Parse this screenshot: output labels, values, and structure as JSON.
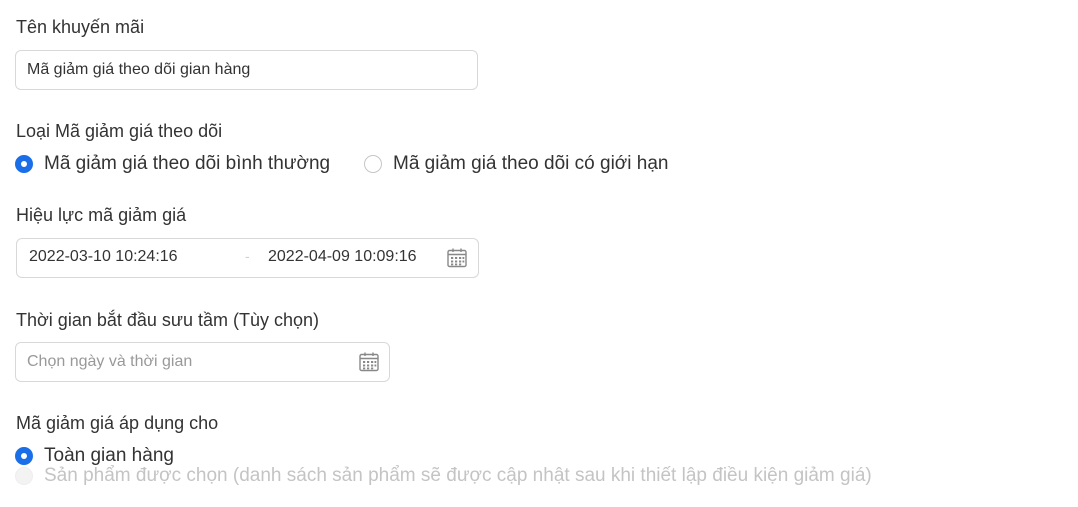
{
  "promo_name": {
    "label": "Tên khuyến mãi",
    "value": "Mã giảm giá theo dõi gian hàng"
  },
  "voucher_type": {
    "label": "Loại Mã giảm giá theo dõi",
    "options": [
      {
        "label": "Mã giảm giá theo dõi bình thường",
        "selected": true
      },
      {
        "label": "Mã giảm giá theo dõi có giới hạn",
        "selected": false
      }
    ]
  },
  "validity": {
    "label": "Hiệu lực mã giảm giá",
    "start": "2022-03-10 10:24:16",
    "separator": "-",
    "end": "2022-04-09 10:09:16",
    "icon": "calendar-icon"
  },
  "collect_start": {
    "label": "Thời gian bắt đầu sưu tầm (Tùy chọn)",
    "placeholder": "Chọn ngày và thời gian",
    "icon": "calendar-icon"
  },
  "applies_to": {
    "label": "Mã giảm giá áp dụng cho",
    "options": [
      {
        "label": "Toàn gian hàng",
        "selected": true,
        "disabled": false
      },
      {
        "label": "Sản phẩm được chọn (danh sách sản phẩm sẽ được cập nhật sau khi thiết lập điều kiện giảm giá)",
        "selected": false,
        "disabled": true
      }
    ]
  },
  "colors": {
    "accent": "#1a6fe8",
    "text": "#333333",
    "placeholder": "#999999",
    "border": "#d8d8d8",
    "disabled_text": "#c4c4c4"
  }
}
